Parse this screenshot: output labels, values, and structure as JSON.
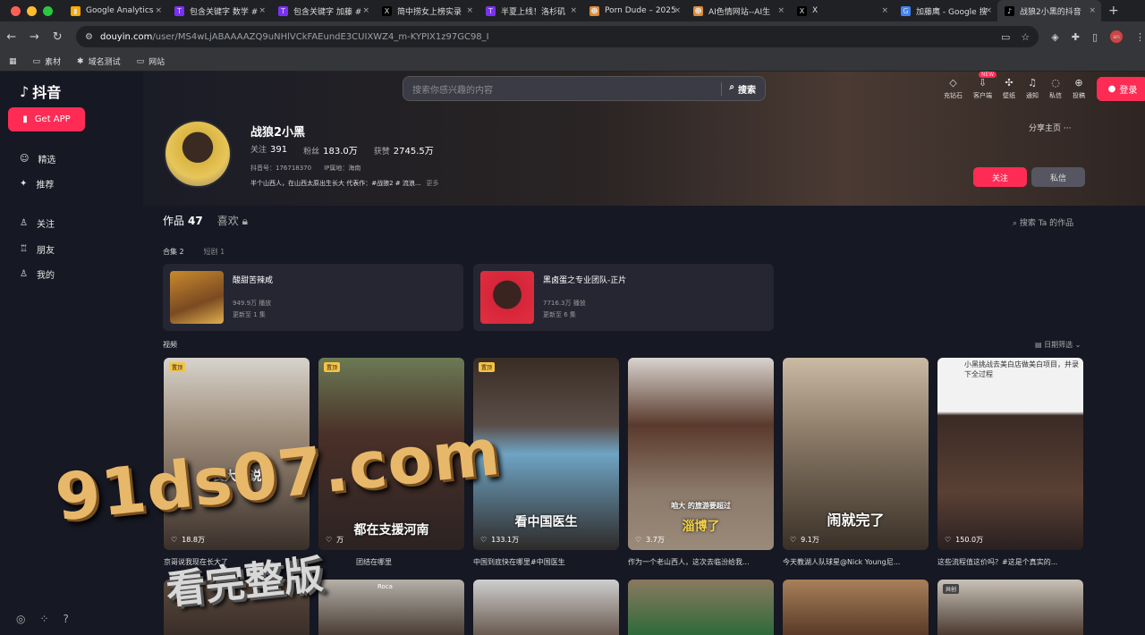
{
  "browser": {
    "tabs": [
      {
        "title": "Google Analytics",
        "icon": "analytics-icon",
        "color": "#f9ab00"
      },
      {
        "title": "包含关键字 数学 #",
        "icon": "t-icon",
        "color": "#7b2ff7"
      },
      {
        "title": "包含关键字 加藤 #",
        "icon": "t-icon",
        "color": "#7b2ff7"
      },
      {
        "title": "简中捞女上榜实录",
        "icon": "x-icon",
        "color": "#000000"
      },
      {
        "title": "半夏上线！洛杉矶",
        "icon": "t-icon",
        "color": "#7b2ff7"
      },
      {
        "title": "Porn Dude – 2025",
        "icon": "dude-icon",
        "color": "#e08a2c"
      },
      {
        "title": "AI色情网站--AI生",
        "icon": "dude-icon",
        "color": "#e08a2c"
      },
      {
        "title": "X",
        "icon": "x-icon",
        "color": "#000000"
      },
      {
        "title": "加藤鹰 - Google 搜",
        "icon": "google-icon",
        "color": "#4285f4"
      },
      {
        "title": "战狼2小黑的抖音",
        "icon": "tiktok-icon",
        "color": "#000000"
      }
    ],
    "active_tab": 9,
    "url_host": "douyin.com",
    "url_rest": "/user/MS4wLjABAAAAZQ9uNHlVCkFAEundE3CUIXWZ4_m-KYPIX1z97GC98_I",
    "bookmarks": [
      "素材",
      "域名测试",
      "网站"
    ],
    "profile_initials": "an"
  },
  "sidebar": {
    "logo": "抖音",
    "get_app": "Get APP",
    "items": [
      "精选",
      "推荐",
      "关注",
      "朋友",
      "我的"
    ]
  },
  "header": {
    "search_placeholder": "搜索你感兴趣的内容",
    "search_button": "搜索",
    "icons": [
      "充钻石",
      "客户端",
      "壁纸",
      "通知",
      "私信",
      "投稿"
    ],
    "new_badge": "NEW",
    "login": "登录"
  },
  "profile": {
    "name": "战狼2小黑",
    "following_label": "关注",
    "following": "391",
    "followers_label": "粉丝",
    "followers": "183.0万",
    "likes_label": "获赞",
    "likes": "2745.5万",
    "douyin_id": "抖音号：176718370",
    "ip": "IP属地：海南",
    "bio": "半个山西人，在山西太原出生长大 代表作：#战狼2 # 流浪...",
    "more": "更多",
    "share": "分享主页",
    "follow": "关注",
    "message": "私信"
  },
  "content_tabs": {
    "works_label": "作品",
    "works_count": "47",
    "likes_label": "喜欢",
    "search_ta": "搜索 Ta 的作品",
    "collections_label": "合集 2",
    "shorts_label": "短剧 1"
  },
  "collections": [
    {
      "title": "酸甜苦辣咸",
      "plays": "949.9万 播放",
      "updated": "更新至 1 集"
    },
    {
      "title": "黑卤蛋之专业团队-正片",
      "plays": "7716.3万 播放",
      "updated": "更新至 6 集"
    }
  ],
  "videos_label": "视频",
  "date_filter": "日期筛选",
  "pin_label": "置顶",
  "videos": [
    {
      "caption": "长大了说",
      "likes": "18.8万",
      "title": "京哥说我现在长大了",
      "pinned": true
    },
    {
      "caption": "都在支援河南",
      "likes": "万",
      "title": "团结在哪里",
      "pinned": true
    },
    {
      "caption": "看中国医生",
      "likes": "133.1万",
      "title": "中国到底快在哪里#中国医生",
      "pinned": true
    },
    {
      "caption": "淄博了",
      "caption_small": "咱大  的旅游要超过",
      "likes": "3.7万",
      "title": "作为一个老山西人，这次去临汾给我...",
      "pinned": false
    },
    {
      "caption": "闹就完了",
      "likes": "9.1万",
      "title": "今天教湖人队球星@Nick Young尼...",
      "pinned": false
    },
    {
      "caption": "",
      "overlay": "小黑挑战去美白店做美白项目，并录下全过程",
      "likes": "150.0万",
      "title": "这些流程值这价吗？#这是个真实的...",
      "pinned": false
    }
  ],
  "second_row_tag": "共创",
  "second_row_text": "Roca",
  "watermark": "91ds07.com",
  "watermark_sub": "看完整版",
  "colors": {
    "accent": "#fe2c55",
    "bg": "#161823",
    "card": "#252632"
  }
}
